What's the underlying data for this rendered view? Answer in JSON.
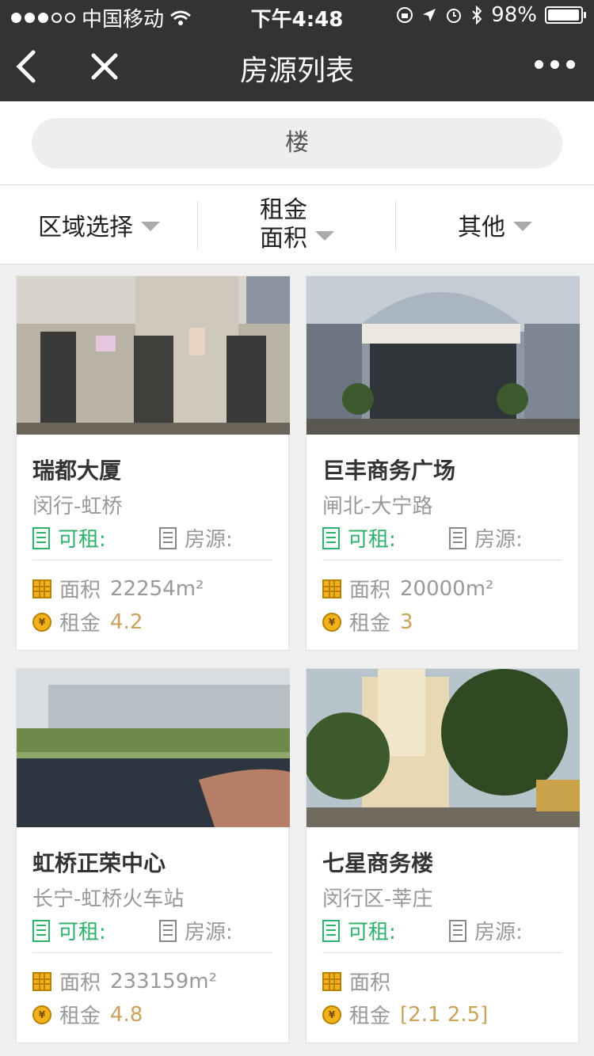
{
  "status": {
    "carrier": "中国移动",
    "time": "下午4:48",
    "battery": "98%",
    "battery_level": 0.98
  },
  "nav": {
    "title": "房源列表",
    "back_icon": "back-chevron-icon",
    "close_icon": "close-icon",
    "more_icon": "more-dots-icon"
  },
  "search": {
    "value": "楼"
  },
  "filters": {
    "region": "区域选择",
    "rent": "租金",
    "area": "面积",
    "other": "其他"
  },
  "labels": {
    "available": "可租:",
    "rooms": "房源:",
    "size": "面积",
    "rent": "租金"
  },
  "listings": [
    {
      "name": "瑞都大厦",
      "district": "闵行-虹桥",
      "size_value": "22254m²",
      "rent_value": "4.2"
    },
    {
      "name": "巨丰商务广场",
      "district": "闸北-大宁路",
      "size_value": "20000m²",
      "rent_value": "3"
    },
    {
      "name": "虹桥正荣中心",
      "district": "长宁-虹桥火车站",
      "size_value": "233159m²",
      "rent_value": "4.8"
    },
    {
      "name": "七星商务楼",
      "district": "闵行区-莘庄",
      "size_value": "",
      "rent_value": "[2.1 2.5]"
    }
  ],
  "colors": {
    "header_bg": "#333333",
    "available_green": "#2db36a",
    "rent_gold": "#c9a35c"
  }
}
